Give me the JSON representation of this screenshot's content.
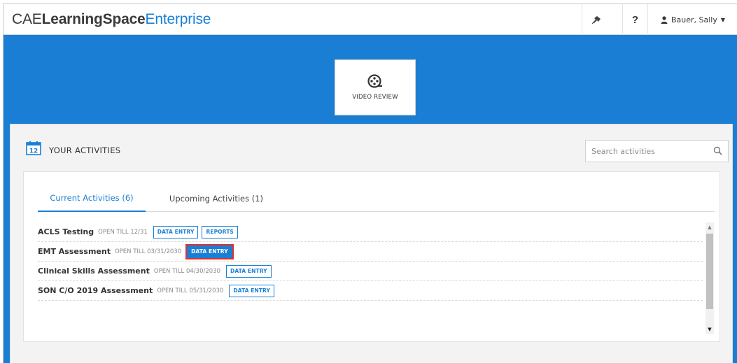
{
  "app": {
    "brand_prefix": "CAE",
    "brand_bold": "LearningSpace",
    "brand_suffix": "Enterprise"
  },
  "header": {
    "help_label": "?",
    "user_name": "Bauer, Sally",
    "icons": {
      "pin": "pin-icon",
      "user": "user-icon",
      "dropdown": "chevron-down-icon"
    }
  },
  "banner": {
    "tile_label": "VIDEO REVIEW",
    "tile_icon": "film-reel-icon"
  },
  "activities": {
    "title": "YOUR ACTIVITIES",
    "calendar_day": "12",
    "search_placeholder": "Search activities",
    "tabs": [
      {
        "label": "Current Activities (6)",
        "active": true
      },
      {
        "label": "Upcoming Activities (1)",
        "active": false
      }
    ],
    "rows": [
      {
        "name": "ACLS Testing",
        "open": "OPEN TILL 12/31",
        "buttons": [
          "DATA ENTRY",
          "REPORTS"
        ]
      },
      {
        "name": "EMT Assessment",
        "open": "OPEN TILL 03/31/2030",
        "buttons": [
          "DATA ENTRY"
        ]
      },
      {
        "name": "Clinical Skills Assessment",
        "open": "OPEN TILL 04/30/2030",
        "buttons": [
          "DATA ENTRY"
        ]
      },
      {
        "name": "SON C/O 2019 Assessment",
        "open": "OPEN TILL 05/31/2030",
        "buttons": [
          "DATA ENTRY"
        ]
      }
    ]
  },
  "colors": {
    "accent": "#1a7fd4",
    "highlight": "#e0302f",
    "panel_bg": "#f3f3f3"
  }
}
